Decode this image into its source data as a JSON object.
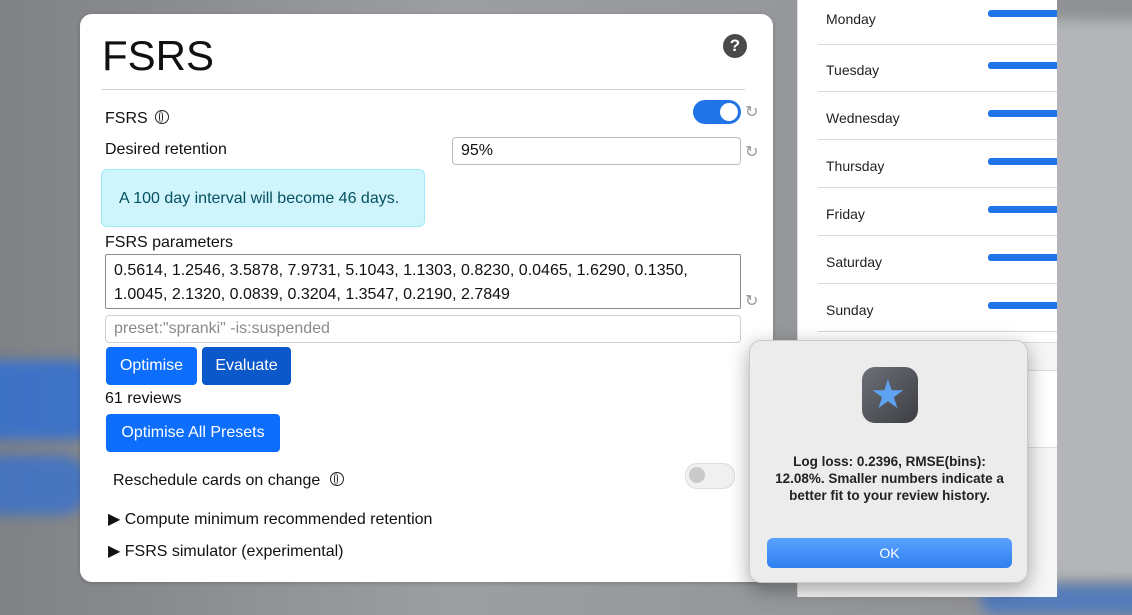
{
  "fsrs_card": {
    "title": "FSRS",
    "help_glyph": "?",
    "fsrs_label": "FSRS",
    "fsrs_enabled": true,
    "desired_retention_label": "Desired retention",
    "desired_retention_value": "95%",
    "interval_info": "A 100 day interval will become 46 days.",
    "parameters_label": "FSRS parameters",
    "parameters_value": "0.5614, 1.2546, 3.5878, 7.9731, 5.1043, 1.1303, 0.8230, 0.0465, 1.6290, 0.1350, 1.0045, 2.1320, 0.0839, 0.3204, 1.3547, 0.2190, 2.7849",
    "search_placeholder": "preset:\"spranki\" -is:suspended",
    "optimise_label": "Optimise",
    "evaluate_label": "Evaluate",
    "reviews_count": "61 reviews",
    "optimise_all_label": "Optimise All Presets",
    "reschedule_label": "Reschedule cards on change",
    "reschedule_enabled": false,
    "compute_min_label": "▶ Compute minimum recommended retention",
    "simulator_label": "▶ FSRS simulator (experimental)"
  },
  "weekdays": [
    {
      "label": "Monday"
    },
    {
      "label": "Tuesday"
    },
    {
      "label": "Wednesday"
    },
    {
      "label": "Thursday"
    },
    {
      "label": "Friday"
    },
    {
      "label": "Saturday"
    },
    {
      "label": "Sunday"
    }
  ],
  "dialog": {
    "message": "Log loss: 0.2396, RMSE(bins): 12.08%. Smaller numbers indicate a better fit to your review history.",
    "ok_label": "OK"
  },
  "icons": {
    "help": "help-circle-icon",
    "globe": "globe-icon",
    "reset": "reset-icon",
    "app": "anki-app-icon"
  },
  "colors": {
    "accent": "#0d6efd",
    "info_bg": "#cff4fc",
    "info_text": "#055160",
    "day_bar": "#1f74e8"
  }
}
